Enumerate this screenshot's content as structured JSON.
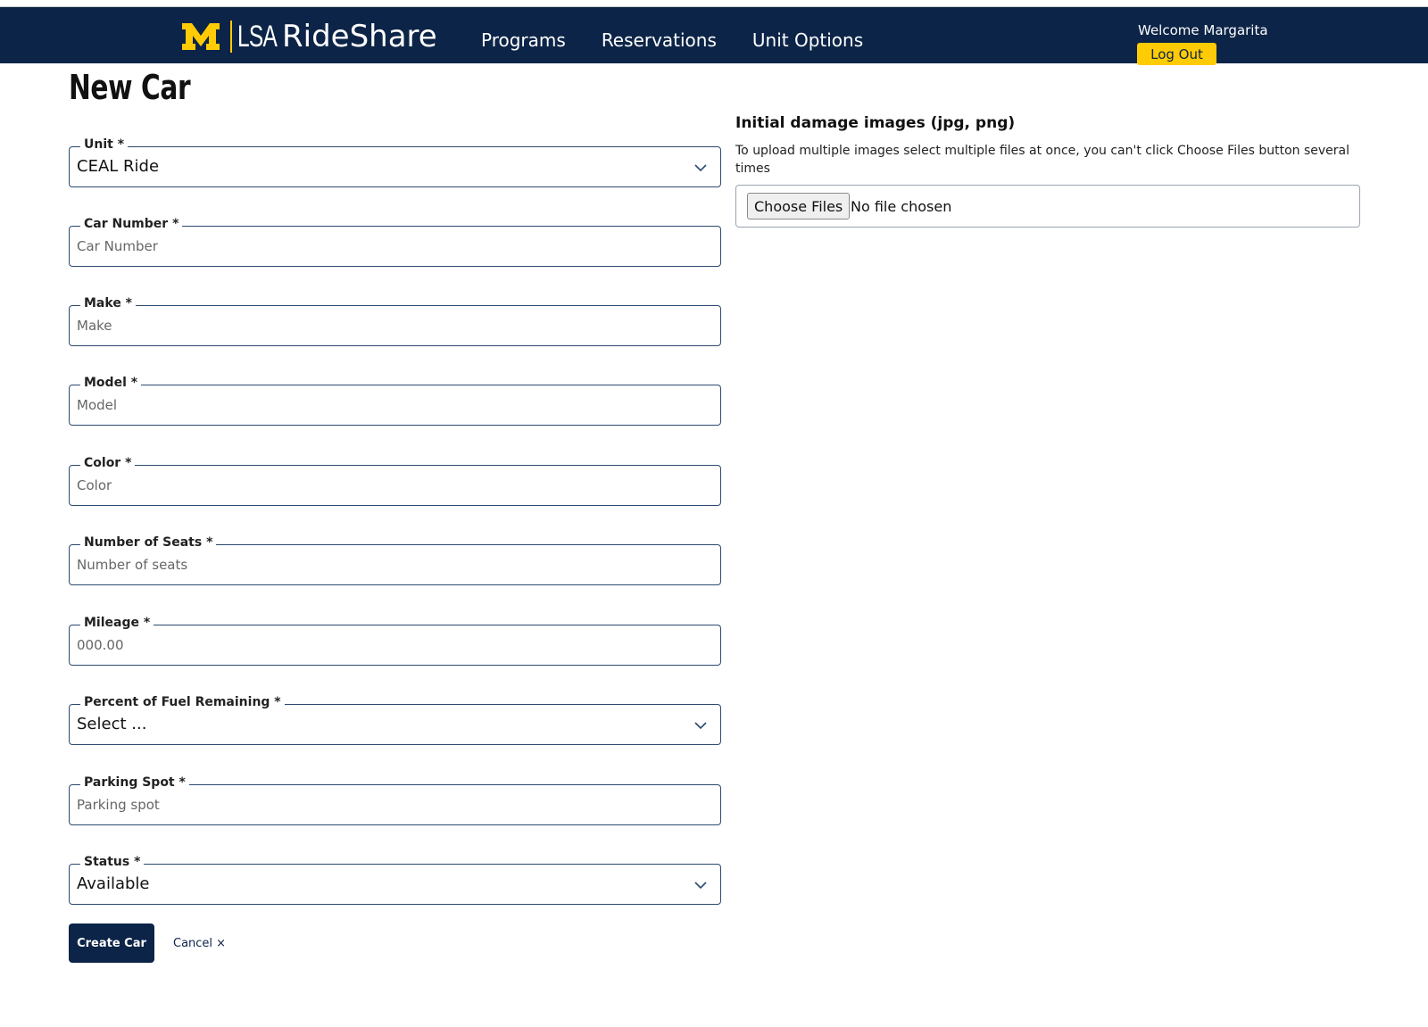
{
  "header": {
    "brand_short": "LSA",
    "brand_name": "RideShare",
    "nav": [
      "Programs",
      "Reservations",
      "Unit Options"
    ],
    "welcome": "Welcome Margarita",
    "logout_label": "Log Out",
    "colors": {
      "navy": "#0c2447",
      "maize": "#ffcb05"
    }
  },
  "page": {
    "title": "New Car"
  },
  "form": {
    "unit": {
      "label": "Unit *",
      "value": "CEAL Ride"
    },
    "car_number": {
      "label": "Car Number *",
      "placeholder": "Car Number"
    },
    "make": {
      "label": "Make *",
      "placeholder": "Make"
    },
    "model": {
      "label": "Model *",
      "placeholder": "Model"
    },
    "color": {
      "label": "Color *",
      "placeholder": "Color"
    },
    "seats": {
      "label": "Number of Seats *",
      "placeholder": "Number of seats"
    },
    "mileage": {
      "label": "Mileage *",
      "placeholder": "000.00"
    },
    "fuel": {
      "label": "Percent of Fuel Remaining *",
      "value": "Select ..."
    },
    "parking": {
      "label": "Parking Spot *",
      "placeholder": "Parking spot"
    },
    "status": {
      "label": "Status *",
      "value": "Available"
    },
    "create_label": "Create Car",
    "cancel_label": "Cancel ×"
  },
  "upload": {
    "title": "Initial damage images (jpg, png)",
    "help": "To upload multiple images select multiple files at once, you can't click Choose Files button several times",
    "button_label": "Choose Files",
    "status": "No file chosen"
  }
}
